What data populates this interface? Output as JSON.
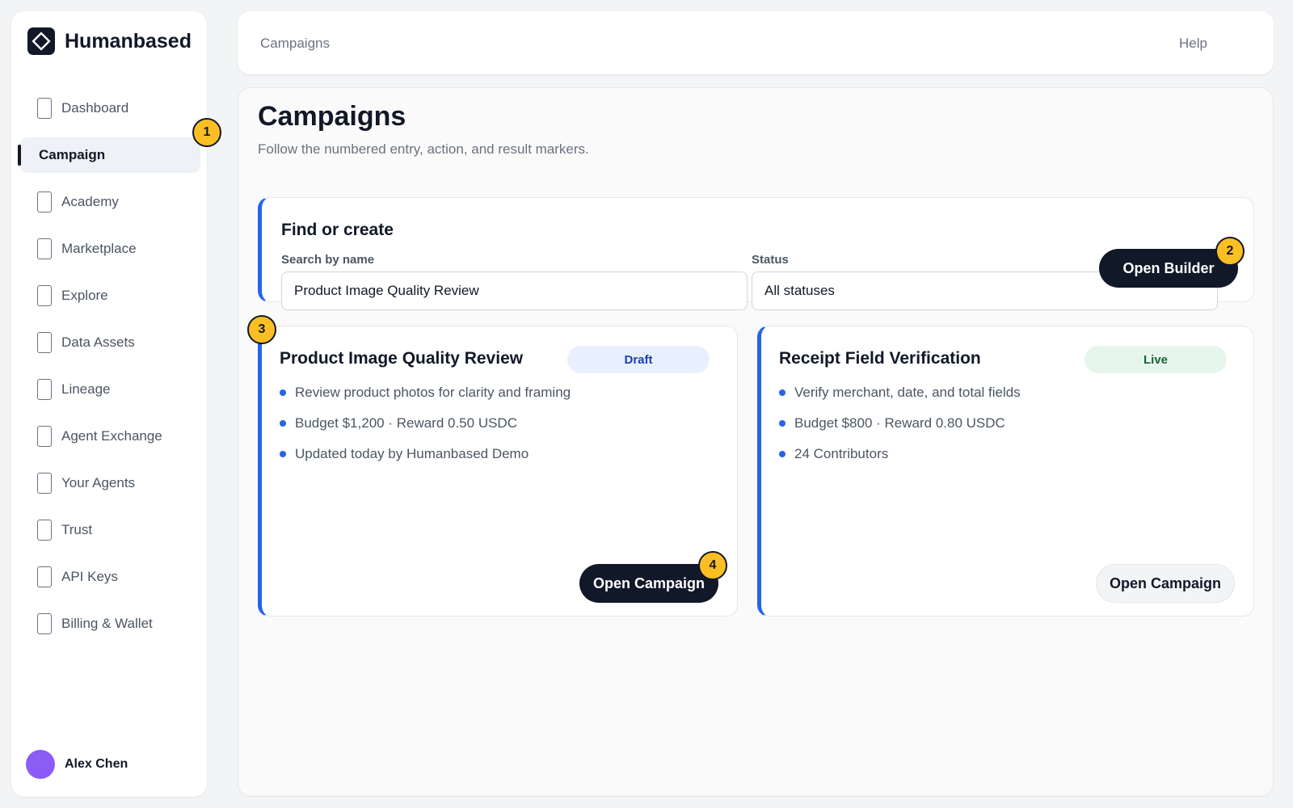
{
  "app": {
    "name": "Humanbased"
  },
  "sidebar": {
    "items": [
      {
        "label": "Dashboard",
        "icon": "page-icon"
      },
      {
        "label": "Campaign",
        "icon": "none",
        "active": true
      },
      {
        "label": "Academy",
        "icon": "page-icon"
      },
      {
        "label": "Marketplace",
        "icon": "page-icon"
      },
      {
        "label": "Explore",
        "icon": "page-icon"
      },
      {
        "label": "Data Assets",
        "icon": "page-icon"
      },
      {
        "label": "Lineage",
        "icon": "page-icon"
      },
      {
        "label": "Agent Exchange",
        "icon": "page-icon"
      },
      {
        "label": "Your Agents",
        "icon": "page-icon"
      },
      {
        "label": "Trust",
        "icon": "page-icon"
      },
      {
        "label": "API Keys",
        "icon": "page-icon"
      },
      {
        "label": "Billing & Wallet",
        "icon": "page-icon"
      }
    ],
    "user": {
      "name": "Alex Chen"
    }
  },
  "topbar": {
    "left_link": "Campaigns",
    "right_link": "Help"
  },
  "page": {
    "title": "Campaigns",
    "subtitle": "Follow the numbered entry, action, and result markers."
  },
  "find": {
    "title": "Find or create",
    "search_label": "Search by name",
    "search_value": "Product Image Quality Review",
    "status_label": "Status",
    "status_value": "All statuses",
    "open_builder_label": "Open Builder"
  },
  "campaigns": [
    {
      "title": "Product Image Quality Review",
      "status": "Draft",
      "details": [
        "Review product photos for clarity and framing",
        "Budget $1,200 · Reward 0.50 USDC",
        "Updated today by Humanbased Demo"
      ],
      "action_label": "Open Campaign"
    },
    {
      "title": "Receipt Field Verification",
      "status": "Live",
      "details": [
        "Verify merchant, date, and total fields",
        "Budget $800 · Reward 0.80 USDC",
        "24 Contributors"
      ],
      "action_label": "Open Campaign"
    }
  ],
  "markers": [
    "1",
    "2",
    "3",
    "4"
  ],
  "colors": {
    "accent": "#2563eb",
    "dark": "#111827",
    "marker": "#fbbf24",
    "avatar": "#8b5cf6",
    "draft_badge": "#e8f0fe",
    "live_badge": "#e7f6ec"
  }
}
